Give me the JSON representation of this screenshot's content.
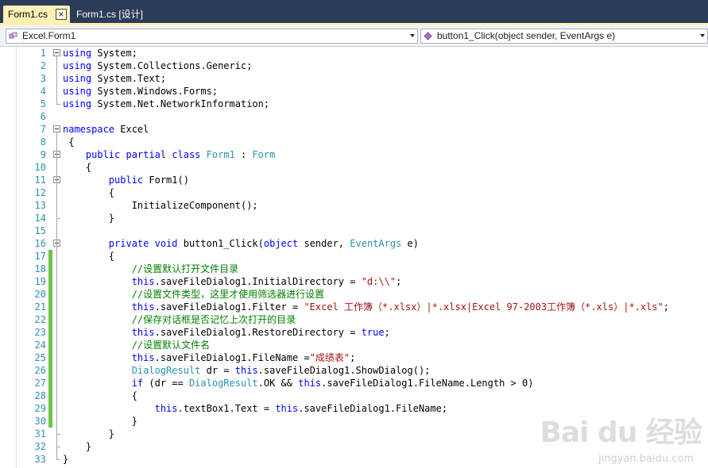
{
  "tabs": [
    {
      "label": "Form1.cs",
      "active": true,
      "close": "×"
    },
    {
      "label": "Form1.cs [设计]",
      "active": false
    }
  ],
  "nav": {
    "class_combo": "Excel.Form1",
    "member_combo": "button1_Click(object sender, EventArgs e)"
  },
  "colors": {
    "keyword": "#0000ff",
    "type": "#2b91af",
    "string": "#a31515",
    "comment": "#008000"
  },
  "code": {
    "lines": [
      {
        "n": "1",
        "t": [
          {
            "k": "kw",
            "s": "using"
          },
          {
            "k": "",
            "s": " System;"
          }
        ]
      },
      {
        "n": "2",
        "t": [
          {
            "k": "kw",
            "s": "using"
          },
          {
            "k": "",
            "s": " System.Collections.Generic;"
          }
        ]
      },
      {
        "n": "3",
        "t": [
          {
            "k": "kw",
            "s": "using"
          },
          {
            "k": "",
            "s": " System.Text;"
          }
        ]
      },
      {
        "n": "4",
        "t": [
          {
            "k": "kw",
            "s": "using"
          },
          {
            "k": "",
            "s": " System.Windows.Forms;"
          }
        ]
      },
      {
        "n": "5",
        "t": [
          {
            "k": "kw",
            "s": "using"
          },
          {
            "k": "",
            "s": " System.Net.NetworkInformation;"
          }
        ]
      },
      {
        "n": "6",
        "t": []
      },
      {
        "n": "7",
        "t": [
          {
            "k": "kw",
            "s": "namespace"
          },
          {
            "k": "",
            "s": " Excel"
          }
        ]
      },
      {
        "n": "8",
        "t": [
          {
            "k": "",
            "s": " {"
          }
        ]
      },
      {
        "n": "9",
        "t": [
          {
            "k": "",
            "s": "    "
          },
          {
            "k": "kw",
            "s": "public partial class"
          },
          {
            "k": "",
            "s": " "
          },
          {
            "k": "ty",
            "s": "Form1"
          },
          {
            "k": "",
            "s": " : "
          },
          {
            "k": "ty",
            "s": "Form"
          }
        ]
      },
      {
        "n": "10",
        "t": [
          {
            "k": "",
            "s": "    {"
          }
        ]
      },
      {
        "n": "11",
        "t": [
          {
            "k": "",
            "s": "        "
          },
          {
            "k": "kw",
            "s": "public"
          },
          {
            "k": "",
            "s": " Form1()"
          }
        ]
      },
      {
        "n": "12",
        "t": [
          {
            "k": "",
            "s": "        {"
          }
        ]
      },
      {
        "n": "13",
        "t": [
          {
            "k": "",
            "s": "            InitializeComponent();"
          }
        ]
      },
      {
        "n": "14",
        "t": [
          {
            "k": "",
            "s": "        }"
          }
        ]
      },
      {
        "n": "15",
        "t": []
      },
      {
        "n": "16",
        "t": [
          {
            "k": "",
            "s": "        "
          },
          {
            "k": "kw",
            "s": "private void"
          },
          {
            "k": "",
            "s": " button1_Click("
          },
          {
            "k": "kw",
            "s": "object"
          },
          {
            "k": "",
            "s": " sender, "
          },
          {
            "k": "ty",
            "s": "EventArgs"
          },
          {
            "k": "",
            "s": " e)"
          }
        ]
      },
      {
        "n": "17",
        "t": [
          {
            "k": "",
            "s": "        {"
          }
        ]
      },
      {
        "n": "18",
        "t": [
          {
            "k": "",
            "s": "            "
          },
          {
            "k": "cm",
            "s": "//设置默认打开文件目录"
          }
        ]
      },
      {
        "n": "19",
        "t": [
          {
            "k": "",
            "s": "            "
          },
          {
            "k": "kw",
            "s": "this"
          },
          {
            "k": "",
            "s": ".saveFileDialog1.InitialDirectory = "
          },
          {
            "k": "st",
            "s": "\"d:\\\\\""
          },
          {
            "k": "",
            "s": ";"
          }
        ]
      },
      {
        "n": "20",
        "t": [
          {
            "k": "",
            "s": "            "
          },
          {
            "k": "cm",
            "s": "//设置文件类型，这里才使用筛选器进行设置"
          }
        ]
      },
      {
        "n": "21",
        "t": [
          {
            "k": "",
            "s": "            "
          },
          {
            "k": "kw",
            "s": "this"
          },
          {
            "k": "",
            "s": ".saveFileDialog1.Filter = "
          },
          {
            "k": "st",
            "s": "\"Excel 工作簿（*.xlsx）|*.xlsx|Excel 97-2003工作簿（*.xls）|*.xls\""
          },
          {
            "k": "",
            "s": ";"
          }
        ]
      },
      {
        "n": "22",
        "t": [
          {
            "k": "",
            "s": "            "
          },
          {
            "k": "cm",
            "s": "//保存对话框是否记忆上次打开的目录"
          }
        ]
      },
      {
        "n": "23",
        "t": [
          {
            "k": "",
            "s": "            "
          },
          {
            "k": "kw",
            "s": "this"
          },
          {
            "k": "",
            "s": ".saveFileDialog1.RestoreDirectory = "
          },
          {
            "k": "kw",
            "s": "true"
          },
          {
            "k": "",
            "s": ";"
          }
        ]
      },
      {
        "n": "24",
        "t": [
          {
            "k": "",
            "s": "            "
          },
          {
            "k": "cm",
            "s": "//设置默认文件名"
          }
        ]
      },
      {
        "n": "25",
        "t": [
          {
            "k": "",
            "s": "            "
          },
          {
            "k": "kw",
            "s": "this"
          },
          {
            "k": "",
            "s": ".saveFileDialog1.FileName ="
          },
          {
            "k": "st",
            "s": "\"成绩表\""
          },
          {
            "k": "",
            "s": ";"
          }
        ]
      },
      {
        "n": "26",
        "t": [
          {
            "k": "",
            "s": "            "
          },
          {
            "k": "ty",
            "s": "DialogResult"
          },
          {
            "k": "",
            "s": " dr = "
          },
          {
            "k": "kw",
            "s": "this"
          },
          {
            "k": "",
            "s": ".saveFileDialog1.ShowDialog();"
          }
        ]
      },
      {
        "n": "27",
        "t": [
          {
            "k": "",
            "s": "            "
          },
          {
            "k": "kw",
            "s": "if"
          },
          {
            "k": "",
            "s": " (dr == "
          },
          {
            "k": "ty",
            "s": "DialogResult"
          },
          {
            "k": "",
            "s": ".OK && "
          },
          {
            "k": "kw",
            "s": "this"
          },
          {
            "k": "",
            "s": ".saveFileDialog1.FileName.Length > 0)"
          }
        ]
      },
      {
        "n": "28",
        "t": [
          {
            "k": "",
            "s": "            {"
          }
        ]
      },
      {
        "n": "29",
        "t": [
          {
            "k": "",
            "s": "                "
          },
          {
            "k": "kw",
            "s": "this"
          },
          {
            "k": "",
            "s": ".textBox1.Text = "
          },
          {
            "k": "kw",
            "s": "this"
          },
          {
            "k": "",
            "s": ".saveFileDialog1.FileName;"
          }
        ]
      },
      {
        "n": "30",
        "t": [
          {
            "k": "",
            "s": "            }"
          }
        ]
      },
      {
        "n": "31",
        "t": [
          {
            "k": "",
            "s": "        }"
          }
        ]
      },
      {
        "n": "32",
        "t": [
          {
            "k": "",
            "s": "    }"
          }
        ]
      },
      {
        "n": "33",
        "t": [
          {
            "k": "",
            "s": "}"
          }
        ]
      }
    ]
  },
  "watermark": {
    "main": "Bai du 经验",
    "sub": "jingyan.baidu.com"
  }
}
